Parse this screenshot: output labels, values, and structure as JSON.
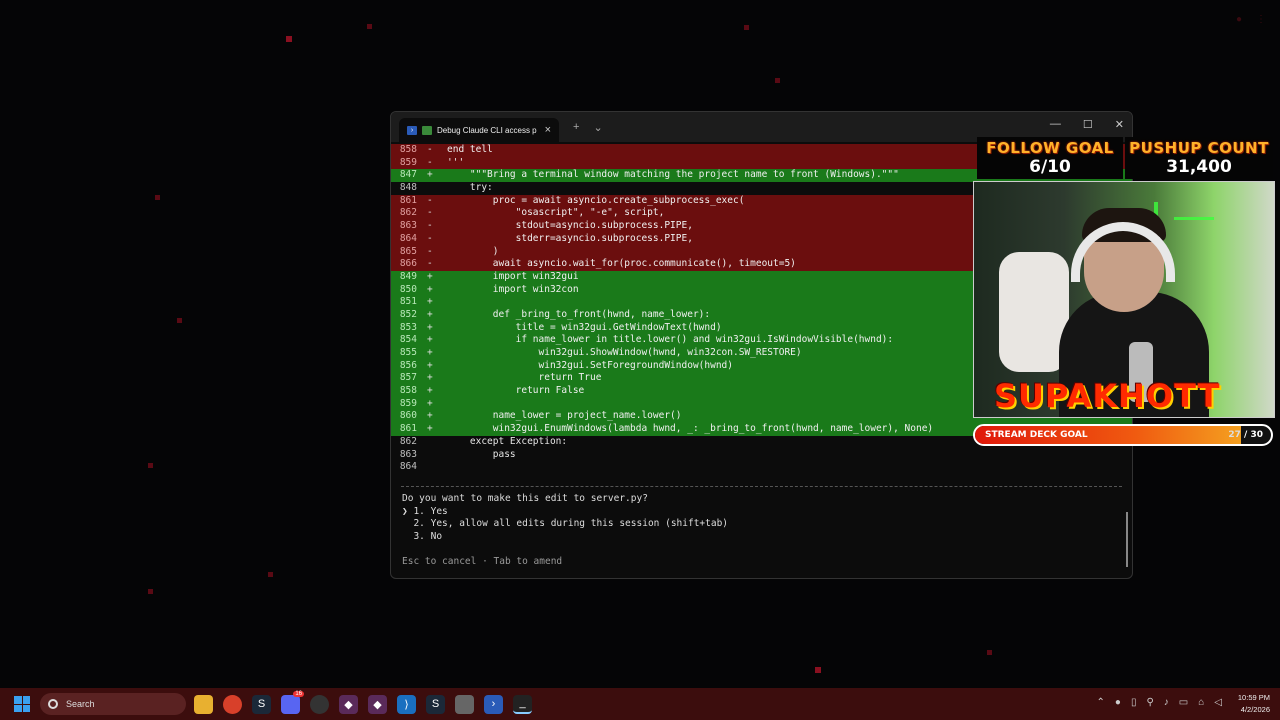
{
  "terminal": {
    "tab_title": "Debug Claude CLI access p",
    "new_tab": "+",
    "dropdown": "⌄",
    "close_tab": "×",
    "minimize": "—",
    "maximize": "☐",
    "close": "✕",
    "lines": [
      {
        "num": "858",
        "mark": "-",
        "type": "del",
        "text": "end tell"
      },
      {
        "num": "859",
        "mark": "-",
        "type": "del",
        "text": "'''"
      },
      {
        "num": "847",
        "mark": "+",
        "type": "add",
        "text": "    \"\"\"Bring a terminal window matching the project name to front (Windows).\"\"\""
      },
      {
        "num": "848",
        "mark": "",
        "type": "plain",
        "text": "    try:"
      },
      {
        "num": "861",
        "mark": "-",
        "type": "del",
        "text": "        proc = await asyncio.create_subprocess_exec("
      },
      {
        "num": "862",
        "mark": "-",
        "type": "del",
        "text": "            \"osascript\", \"-e\", script,"
      },
      {
        "num": "863",
        "mark": "-",
        "type": "del",
        "text": "            stdout=asyncio.subprocess.PIPE,"
      },
      {
        "num": "864",
        "mark": "-",
        "type": "del",
        "text": "            stderr=asyncio.subprocess.PIPE,"
      },
      {
        "num": "865",
        "mark": "-",
        "type": "del",
        "text": "        )"
      },
      {
        "num": "866",
        "mark": "-",
        "type": "del",
        "text": "        await asyncio.wait_for(proc.communicate(), timeout=5)"
      },
      {
        "num": "849",
        "mark": "+",
        "type": "add",
        "text": "        import win32gui"
      },
      {
        "num": "850",
        "mark": "+",
        "type": "add",
        "text": "        import win32con"
      },
      {
        "num": "851",
        "mark": "+",
        "type": "add",
        "text": ""
      },
      {
        "num": "852",
        "mark": "+",
        "type": "add",
        "text": "        def _bring_to_front(hwnd, name_lower):"
      },
      {
        "num": "853",
        "mark": "+",
        "type": "add",
        "text": "            title = win32gui.GetWindowText(hwnd)"
      },
      {
        "num": "854",
        "mark": "+",
        "type": "add",
        "text": "            if name_lower in title.lower() and win32gui.IsWindowVisible(hwnd):"
      },
      {
        "num": "855",
        "mark": "+",
        "type": "add",
        "text": "                win32gui.ShowWindow(hwnd, win32con.SW_RESTORE)"
      },
      {
        "num": "856",
        "mark": "+",
        "type": "add",
        "text": "                win32gui.SetForegroundWindow(hwnd)"
      },
      {
        "num": "857",
        "mark": "+",
        "type": "add",
        "text": "                return True"
      },
      {
        "num": "858",
        "mark": "+",
        "type": "add",
        "text": "            return False"
      },
      {
        "num": "859",
        "mark": "+",
        "type": "add",
        "text": ""
      },
      {
        "num": "860",
        "mark": "+",
        "type": "add",
        "text": "        name_lower = project_name.lower()"
      },
      {
        "num": "861",
        "mark": "+",
        "type": "add",
        "text": "        win32gui.EnumWindows(lambda hwnd, _: _bring_to_front(hwnd, name_lower), None)"
      },
      {
        "num": "862",
        "mark": "",
        "type": "plain",
        "text": "    except Exception:"
      },
      {
        "num": "863",
        "mark": "",
        "type": "plain",
        "text": "        pass"
      },
      {
        "num": "864",
        "mark": "",
        "type": "plain",
        "text": ""
      }
    ],
    "prompt": {
      "question": "Do you want to make this edit to server.py?",
      "option1": "❯ 1. Yes",
      "option2": "  2. Yes, allow all edits during this session (shift+tab)",
      "option3": "  3. No",
      "hint": "Esc to cancel · Tab to amend"
    }
  },
  "overlay": {
    "follow_goal_title": "FOLLOW GOAL",
    "follow_goal_value": "6/10",
    "pushup_title": "PUSHUP COUNT",
    "pushup_value": "31,400",
    "streamer_name": "SUPAKHOTT",
    "deck_goal_label": "STREAM DECK GOAL",
    "deck_goal_current": "27",
    "deck_goal_sep": " / ",
    "deck_goal_total": "30",
    "deck_goal_progress": 0.9
  },
  "taskbar": {
    "search_placeholder": "Search",
    "time": "10:59 PM",
    "date": "4/2/2026",
    "badge": "16"
  },
  "colors": {
    "del_bg": "#6b0e0e",
    "add_bg": "#1a7a1a",
    "taskbar_bg": "#3c0d0d",
    "goal_title": "#ffb22a"
  }
}
